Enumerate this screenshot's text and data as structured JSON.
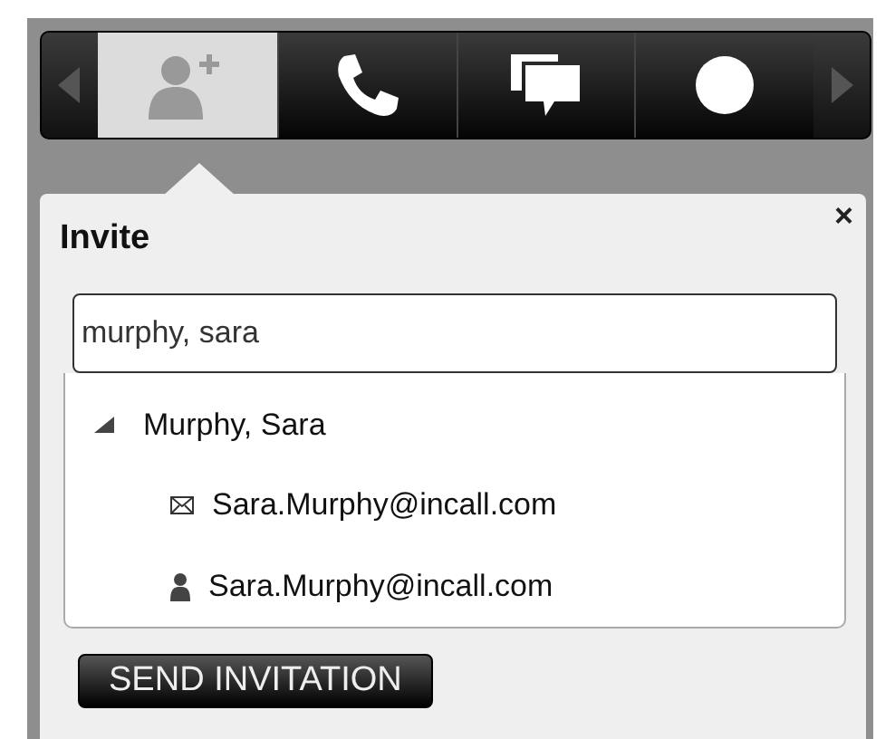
{
  "toolbar": {
    "tabs": [
      {
        "kind": "add-contact",
        "selected": true
      },
      {
        "kind": "phone",
        "selected": false
      },
      {
        "kind": "chat",
        "selected": false
      },
      {
        "kind": "record",
        "selected": false
      }
    ]
  },
  "dialog": {
    "title": "Invite",
    "close": "×",
    "search": {
      "value": "murphy, sara"
    },
    "suggestions": [
      {
        "label": "Murphy, Sara",
        "expanded": true,
        "children": [
          {
            "kind": "email",
            "label": "Sara.Murphy@incall.com"
          },
          {
            "kind": "user",
            "label": "Sara.Murphy@incall.com"
          }
        ]
      }
    ],
    "button": "SEND INVITATION"
  }
}
